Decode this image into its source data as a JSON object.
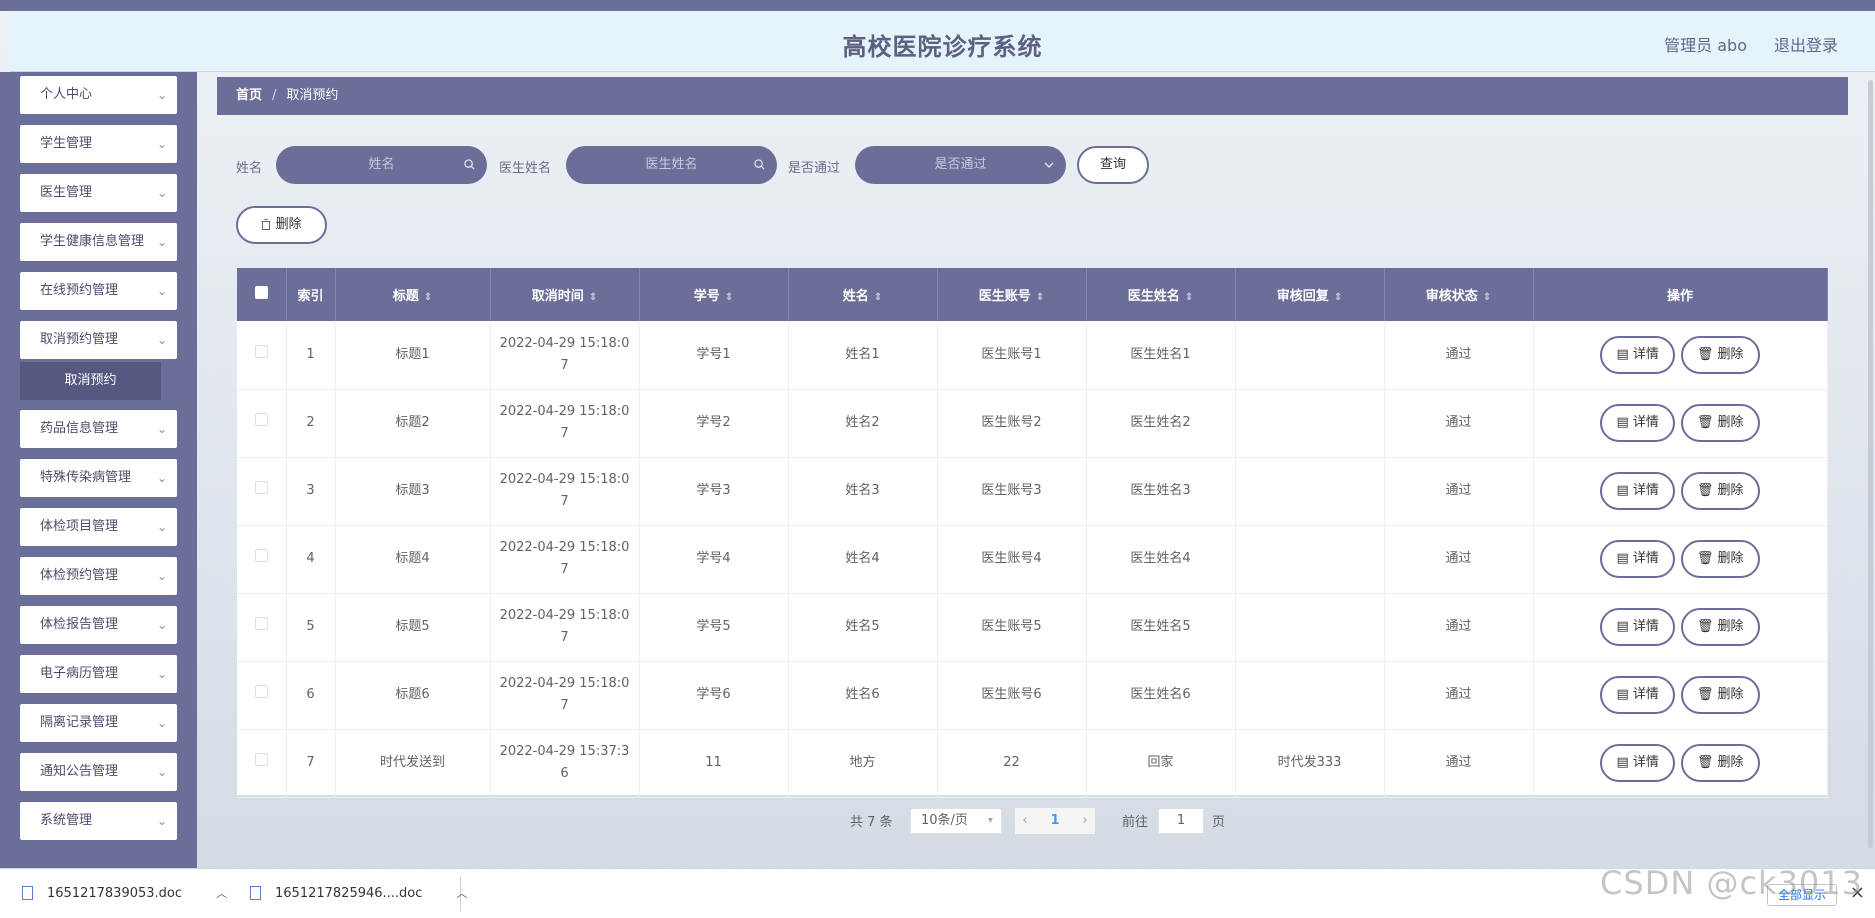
{
  "header": {
    "title": "高校医院诊疗系统",
    "user": "管理员 abo",
    "logout": "退出登录"
  },
  "sidebar": {
    "items": [
      {
        "label": "个人中心"
      },
      {
        "label": "学生管理"
      },
      {
        "label": "医生管理"
      },
      {
        "label": "学生健康信息管理"
      },
      {
        "label": "在线预约管理"
      },
      {
        "label": "取消预约管理"
      },
      {
        "label": "药品信息管理"
      },
      {
        "label": "特殊传染病管理"
      },
      {
        "label": "体检项目管理"
      },
      {
        "label": "体检预约管理"
      },
      {
        "label": "体检报告管理"
      },
      {
        "label": "电子病历管理"
      },
      {
        "label": "隔离记录管理"
      },
      {
        "label": "通知公告管理"
      },
      {
        "label": "系统管理"
      }
    ],
    "active_sub": "取消预约",
    "chevron": "⌄"
  },
  "breadcrumb": {
    "home": "首页",
    "separator": "/",
    "current": "取消预约"
  },
  "search": {
    "name_label": "姓名",
    "name_placeholder": "姓名",
    "doctor_label": "医生姓名",
    "doctor_placeholder": "医生姓名",
    "pass_label": "是否通过",
    "pass_placeholder": "是否通过",
    "query_button": "查询",
    "search_icon": "search-icon",
    "dropdown_icon": "chevron-down-icon"
  },
  "actions": {
    "delete_button": "删除"
  },
  "table": {
    "columns": [
      "索引",
      "标题",
      "取消时间",
      "学号",
      "姓名",
      "医生账号",
      "医生姓名",
      "审核回复",
      "审核状态",
      "操作"
    ],
    "rows": [
      {
        "index": "1",
        "title": "标题1",
        "time1": "2022-04-29 15:18:0",
        "time2": "7",
        "student_no": "学号1",
        "name": "姓名1",
        "doctor_account": "医生账号1",
        "doctor_name": "医生姓名1",
        "reply": "",
        "status": "通过"
      },
      {
        "index": "2",
        "title": "标题2",
        "time1": "2022-04-29 15:18:0",
        "time2": "7",
        "student_no": "学号2",
        "name": "姓名2",
        "doctor_account": "医生账号2",
        "doctor_name": "医生姓名2",
        "reply": "",
        "status": "通过"
      },
      {
        "index": "3",
        "title": "标题3",
        "time1": "2022-04-29 15:18:0",
        "time2": "7",
        "student_no": "学号3",
        "name": "姓名3",
        "doctor_account": "医生账号3",
        "doctor_name": "医生姓名3",
        "reply": "",
        "status": "通过"
      },
      {
        "index": "4",
        "title": "标题4",
        "time1": "2022-04-29 15:18:0",
        "time2": "7",
        "student_no": "学号4",
        "name": "姓名4",
        "doctor_account": "医生账号4",
        "doctor_name": "医生姓名4",
        "reply": "",
        "status": "通过"
      },
      {
        "index": "5",
        "title": "标题5",
        "time1": "2022-04-29 15:18:0",
        "time2": "7",
        "student_no": "学号5",
        "name": "姓名5",
        "doctor_account": "医生账号5",
        "doctor_name": "医生姓名5",
        "reply": "",
        "status": "通过"
      },
      {
        "index": "6",
        "title": "标题6",
        "time1": "2022-04-29 15:18:0",
        "time2": "7",
        "student_no": "学号6",
        "name": "姓名6",
        "doctor_account": "医生账号6",
        "doctor_name": "医生姓名6",
        "reply": "",
        "status": "通过"
      },
      {
        "index": "7",
        "title": "时代发送到",
        "time1": "2022-04-29 15:37:3",
        "time2": "6",
        "student_no": "11",
        "name": "地方",
        "doctor_account": "22",
        "doctor_name": "回家",
        "reply": "时代发333",
        "status": "通过"
      }
    ],
    "detail_label": "详情",
    "delete_label": "删除"
  },
  "pagination": {
    "total": "共 7 条",
    "page_size": "10条/页",
    "current_page": "1",
    "goto_label": "前往",
    "goto_value": "1",
    "page_unit": "页"
  },
  "downloads": {
    "files": [
      "1651217839053.doc",
      "1651217825946....doc"
    ],
    "show_all": "全部显示"
  },
  "watermark": "CSDN @ck3013",
  "colors": {
    "primary": "#6b6e98",
    "header_bg": "#e5f3fb",
    "sidebar_active": "#55587f"
  }
}
